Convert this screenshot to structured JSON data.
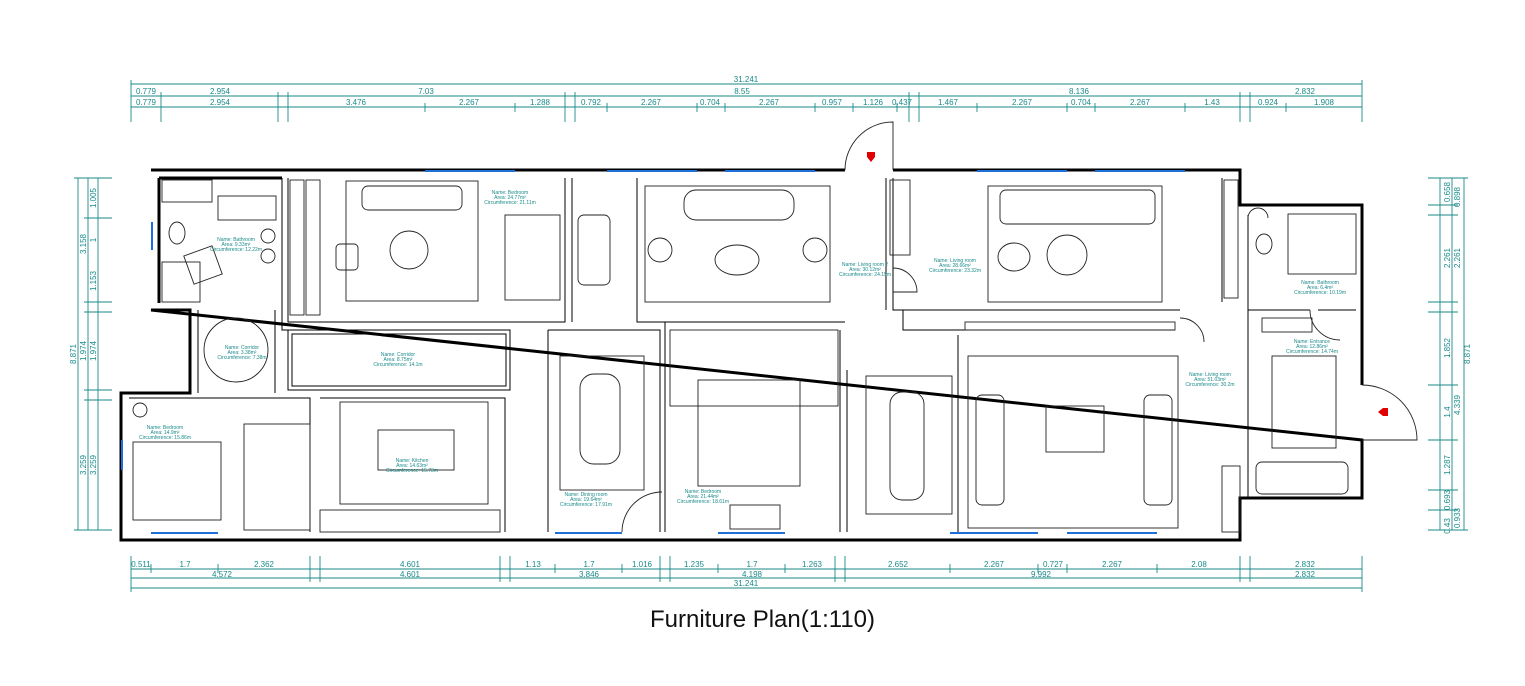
{
  "title": "Furniture Plan(1:110)",
  "dimensions": {
    "top_total": "31.241",
    "top_row1": [
      "0.779",
      "2.954",
      "7.03",
      "8.55",
      "8.136",
      "2.832"
    ],
    "top_row2": [
      "0.779",
      "2.954",
      "3.476",
      "2.267",
      "1.288",
      "0.792",
      "2.267",
      "0.704",
      "2.267",
      "0.957",
      "1.126",
      "0.437",
      "1.467",
      "2.267",
      "0.704",
      "2.267",
      "1.43",
      "0.924",
      "1.908"
    ],
    "bottom_row1": [
      "0.511",
      "1.7",
      "2.362",
      "4.601",
      "1.13",
      "1.7",
      "1.016",
      "1.235",
      "1.7",
      "1.263",
      "2.652",
      "2.267",
      "0.727",
      "2.267",
      "2.08",
      "2.832"
    ],
    "bottom_row2": [
      "4.572",
      "4.601",
      "3.846",
      "4.198",
      "9.992",
      "2.832"
    ],
    "bottom_total": "31.241",
    "left_outer": [
      "1.005",
      "3.158",
      "1",
      "1.153",
      "1.974",
      "1.974",
      "3.259",
      "3.259"
    ],
    "left_total": "8.871",
    "right_outer": [
      "0.658",
      "0.898",
      "2.261",
      "2.261",
      "1.852",
      "4.339",
      "1.4",
      "1.287",
      "0.693",
      "0.933",
      "0.43"
    ],
    "right_total": "8.871"
  },
  "rooms": [
    {
      "name": "Name: Bathroom",
      "area": "Area: 9.33m²",
      "circ": "Circumference: 12.22m"
    },
    {
      "name": "Name: Bedroom",
      "area": "Area: 24.77m²",
      "circ": "Circumference: 21.11m"
    },
    {
      "name": "Name: Living room 2",
      "area": "Area: 30.12m²",
      "circ": "Circumference: 24.15m"
    },
    {
      "name": "Name: Living room",
      "area": "Area: 28.66m²",
      "circ": "Circumference: 23.32m"
    },
    {
      "name": "Name: Bathroom",
      "area": "Area: 6.4m²",
      "circ": "Circumference: 10.19m"
    },
    {
      "name": "Name: Corridor",
      "area": "Area: 3.38m²",
      "circ": "Circumference: 7.38m"
    },
    {
      "name": "Name: Corridor",
      "area": "Area: 8.75m²",
      "circ": "Circumference: 14.1m"
    },
    {
      "name": "Name: Entrance",
      "area": "Area: 12.86m²",
      "circ": "Circumference: 14.74m"
    },
    {
      "name": "Name: Living room",
      "area": "Area: 51.03m²",
      "circ": "Circumference: 30.2m"
    },
    {
      "name": "Name: Bedroom",
      "area": "Area: 14.9m²",
      "circ": "Circumference: 15.86m"
    },
    {
      "name": "Name: Kitchen",
      "area": "Area: 14.63m²",
      "circ": "Circumference: 15.73m"
    },
    {
      "name": "Name: Dining room",
      "area": "Area: 19.64m²",
      "circ": "Circumference: 17.91m"
    },
    {
      "name": "Name: Bedroom",
      "area": "Area: 21.44m²",
      "circ": "Circumference: 18.61m"
    }
  ]
}
